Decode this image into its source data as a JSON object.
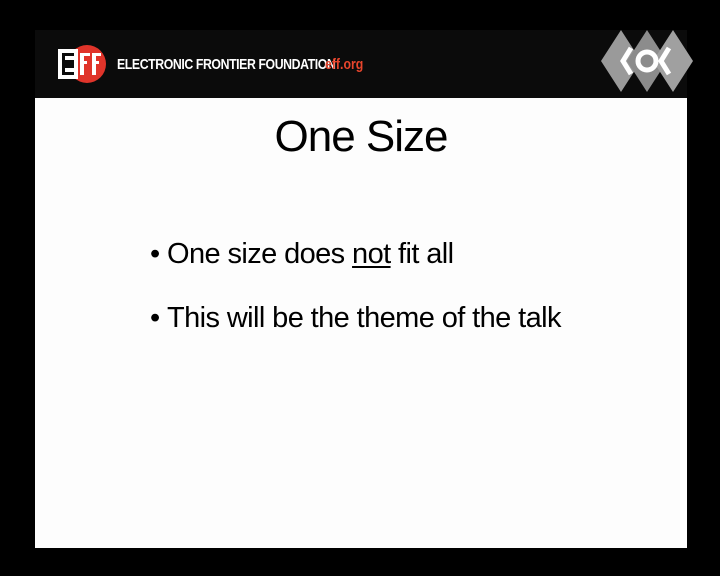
{
  "header": {
    "org_name": "ELECTRONIC FRONTIER FOUNDATION",
    "org_url": "eff.org",
    "logo_letters": "EFF",
    "colors": {
      "brand_red": "#e0342a",
      "url_red": "#e8452c",
      "header_bg": "#0b0b0b"
    },
    "icons": {
      "eff_logo": "eff-logo-icon",
      "conference_logo": "conference-logo-icon"
    }
  },
  "slide": {
    "title": "One Size",
    "bullets": [
      {
        "marker": "•",
        "pre": "One size does ",
        "emphasis": "not",
        "post": " fit all"
      },
      {
        "marker": "•",
        "pre": "This will be the theme of the talk",
        "emphasis": "",
        "post": ""
      }
    ]
  }
}
